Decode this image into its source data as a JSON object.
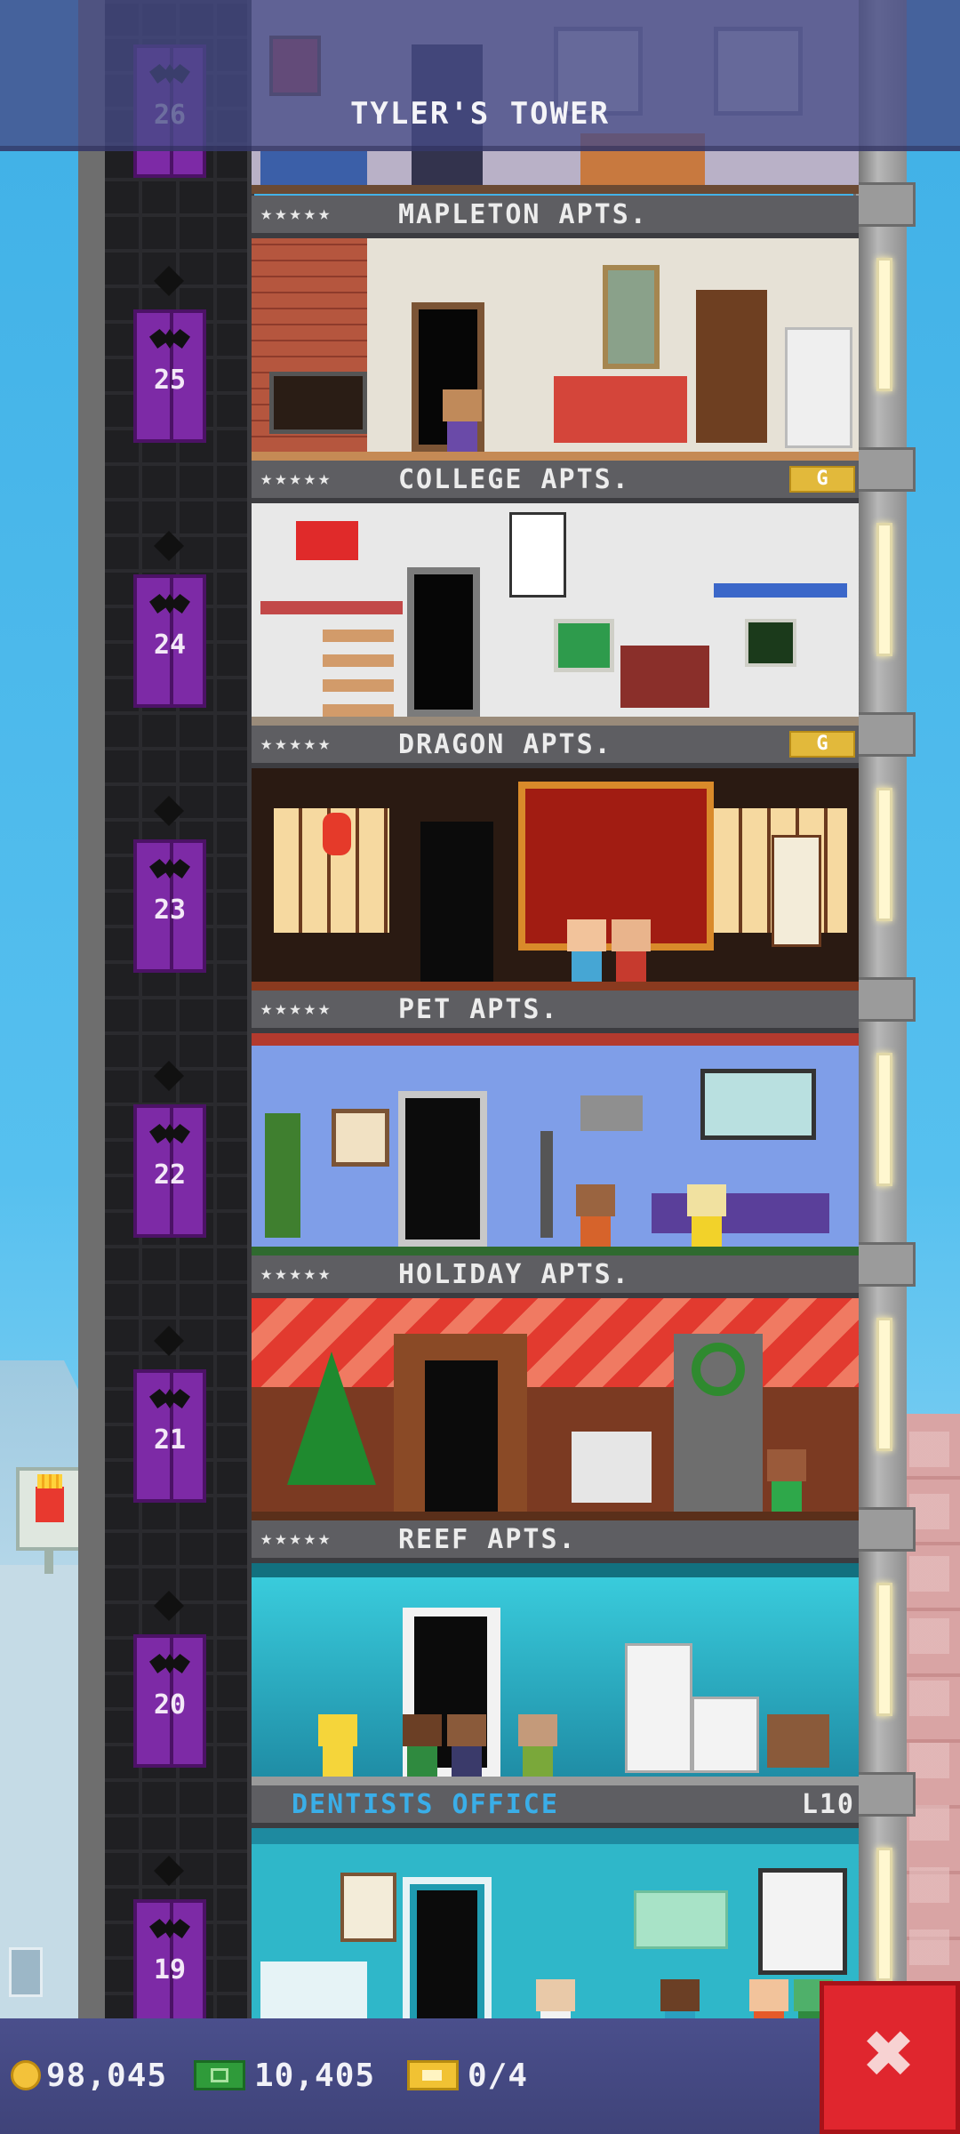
{
  "header": {
    "title": "TYLER'S TOWER"
  },
  "elevator": {
    "floor_numbers": [
      "26",
      "25",
      "24",
      "23",
      "22",
      "21",
      "20",
      "19"
    ]
  },
  "floors": [
    {
      "name": "MAPLETON APTS.",
      "stars": "★★★★★",
      "badge": ""
    },
    {
      "name": "COLLEGE APTS.",
      "stars": "★★★★★",
      "badge": "G"
    },
    {
      "name": "DRAGON APTS.",
      "stars": "★★★★★",
      "badge": "G"
    },
    {
      "name": "PET APTS.",
      "stars": "★★★★★",
      "badge": ""
    },
    {
      "name": "HOLIDAY APTS.",
      "stars": "★★★★★",
      "badge": ""
    },
    {
      "name": "REEF APTS.",
      "stars": "★★★★★",
      "badge": ""
    },
    {
      "name": "DENTISTS OFFICE",
      "stars": "",
      "badge": "L10"
    }
  ],
  "status_bar": {
    "coins": "98,045",
    "bux": "10,405",
    "tickets": "0/4"
  },
  "close_button": {
    "label": "✖"
  },
  "colors": {
    "sky": "#4fb8ea",
    "elevator_car": "#7d2aa6",
    "status_bar": "#4a4f8c",
    "close_button": "#e0262e",
    "dentist_label": "#3aaee8"
  }
}
